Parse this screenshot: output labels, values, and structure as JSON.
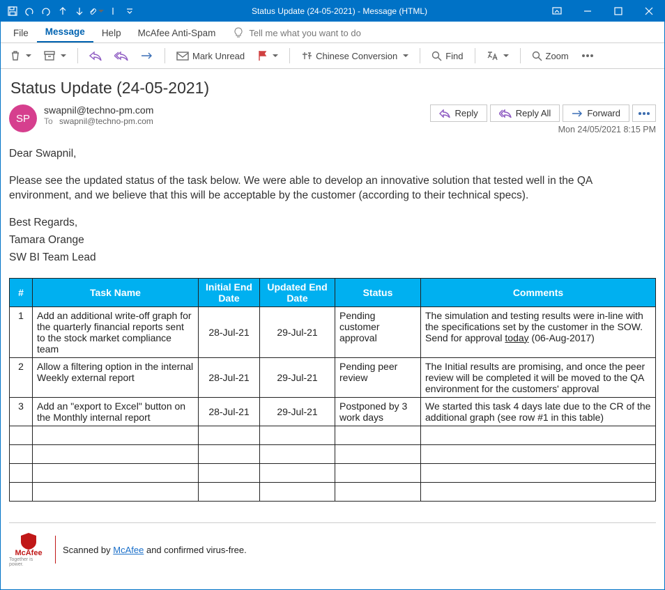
{
  "window_title": "Status Update (24-05-2021)  -  Message (HTML)",
  "menubar": {
    "file": "File",
    "message": "Message",
    "help": "Help",
    "mcafee": "McAfee Anti-Spam",
    "tell_me": "Tell me what you want to do"
  },
  "toolbar": {
    "mark_unread": "Mark Unread",
    "chinese": "Chinese Conversion",
    "find": "Find",
    "zoom": "Zoom"
  },
  "mail": {
    "subject": "Status Update (24-05-2021)",
    "avatar_initials": "SP",
    "from_email": "swapnil@techno-pm.com",
    "to_label": "To",
    "to_email": "swapnil@techno-pm.com",
    "timestamp": "Mon 24/05/2021 8:15 PM",
    "actions": {
      "reply": "Reply",
      "reply_all": "Reply All",
      "forward": "Forward"
    },
    "body": {
      "greeting": "Dear Swapnil,",
      "para": "Please see the updated status of the task below. We were able to develop an innovative solution that tested well in the QA environment, and we believe that this will be acceptable by the customer (according to their technical specs).",
      "regards1": "Best Regards,",
      "regards2": "Tamara Orange",
      "regards3": "SW BI Team Lead"
    }
  },
  "table": {
    "headers": {
      "num": "#",
      "task": "Task Name",
      "initial": "Initial End Date",
      "updated": "Updated End Date",
      "status": "Status",
      "comments": "Comments"
    },
    "rows": [
      {
        "num": "1",
        "task": "Add an additional write-off graph for the quarterly financial reports sent to the stock market compliance team",
        "initial": "28-Jul-21",
        "updated": "29-Jul-21",
        "status": "Pending customer approval",
        "comments_pre": "The simulation and testing results were in-line with the specifications set by the customer in the SOW. Send for approval ",
        "comments_underline": "today",
        "comments_post": " (06-Aug-2017)"
      },
      {
        "num": "2",
        "task": "Allow a filtering option in the internal Weekly external report",
        "initial": "28-Jul-21",
        "updated": "29-Jul-21",
        "status": "Pending peer review",
        "comments": "The Initial results are promising, and once the peer review will be completed it will be moved to the QA environment for the customers' approval"
      },
      {
        "num": "3",
        "task": "Add an \"export to Excel\" button on the Monthly internal report",
        "initial": "28-Jul-21",
        "updated": "29-Jul-21",
        "status": "Postponed by 3 work days",
        "comments": "We started this task 4 days late due to the CR of the additional graph (see row #1 in this table)"
      }
    ]
  },
  "mcafee": {
    "brand": "McAfee",
    "tagline": "Together is power.",
    "scanned_pre": "Scanned by ",
    "link": "McAfee",
    "scanned_post": " and confirmed virus-free."
  }
}
